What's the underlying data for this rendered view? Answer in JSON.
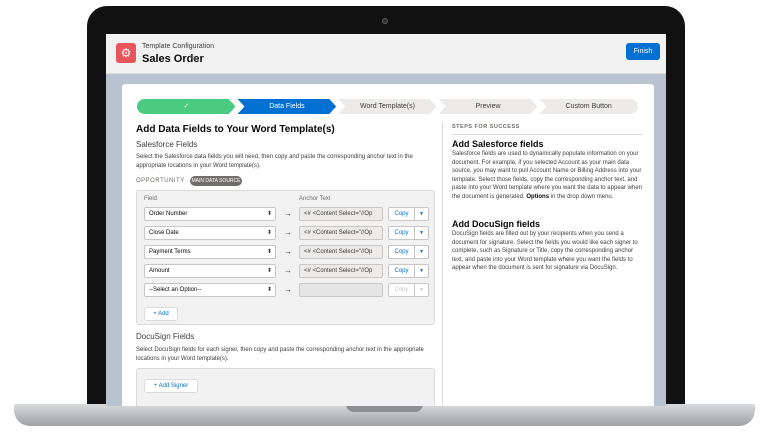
{
  "header": {
    "subtitle": "Template Configuration",
    "title": "Sales Order",
    "finish_label": "Finish"
  },
  "path": {
    "steps": [
      {
        "label": "✓",
        "state": "complete"
      },
      {
        "label": "Data Fields",
        "state": "current"
      },
      {
        "label": "Word Template(s)",
        "state": "upcoming"
      },
      {
        "label": "Preview",
        "state": "upcoming"
      },
      {
        "label": "Custom Button",
        "state": "upcoming"
      }
    ]
  },
  "main": {
    "heading": "Add Data Fields to Your Word Template(s)",
    "salesforce_heading": "Salesforce Fields",
    "salesforce_desc": "Select the Salesforce data fields you will need, then copy and paste the corresponding anchor text in the appropriate locations in your Word template(s).",
    "object_label": "OPPORTUNITY",
    "object_badge": "MAIN DATA SOURCE",
    "col_field": "Field",
    "col_anchor": "Anchor Text",
    "rows": [
      {
        "field": "Order Number",
        "anchor": "<# <Content Select=\"//Op",
        "copy": "Copy"
      },
      {
        "field": "Close Date",
        "anchor": "<# <Content Select=\"//Op",
        "copy": "Copy"
      },
      {
        "field": "Payment Terms",
        "anchor": "<# <Content Select=\"//Op",
        "copy": "Copy"
      },
      {
        "field": "Amount",
        "anchor": "<# <Content Select=\"//Op",
        "copy": "Copy"
      },
      {
        "field": "--Select an Option--",
        "anchor": "",
        "copy": "Copy"
      }
    ],
    "add_label": "+ Add",
    "docusign_heading": "DocuSign Fields",
    "docusign_desc": "Select DocuSign fields for each signer, then copy and paste the corresponding anchor text in the appropriate locations in your Word template(s).",
    "add_signer_label": "+ Add Signer"
  },
  "side": {
    "caption": "STEPS FOR SUCCESS",
    "h1": "Add Salesforce fields",
    "p1_a": "Salesforce fields are used to dynamically populate information on your document. For example, if you selected Account as your main data source, you may want to pull Account Name or Billing Address into your template. Select those fields, copy the corresponding anchor text, and paste into your Word template where you want the data to appear when the document is generated. ",
    "p1_bold": "Options",
    "p1_b": " in the drop down menu.",
    "h2": "Add DocuSign fields",
    "p2": "DocuSign fields are filled out by your recipients when you send a document for signature. Select the fields you would like each signer to complete, such as Signature or Title, copy the corresponding anchor text, and paste into your Word template where you want the fields to appear when the document is sent for signature via DocuSign."
  },
  "colors": {
    "brand": "#0070d2",
    "complete": "#4bca81",
    "app_icon": "#e8555b"
  }
}
